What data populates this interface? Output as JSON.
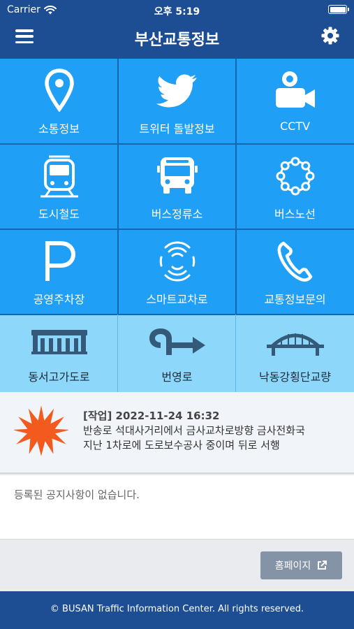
{
  "status_bar": {
    "carrier": "Carrier",
    "time": "오후 5:19"
  },
  "navbar": {
    "title": "부산교통정보"
  },
  "tiles": [
    {
      "label": "소통정보",
      "icon": "map-pin-icon"
    },
    {
      "label": "트위터 돌발정보",
      "icon": "twitter-bird-icon"
    },
    {
      "label": "CCTV",
      "icon": "video-camera-icon"
    },
    {
      "label": "도시철도",
      "icon": "subway-train-icon"
    },
    {
      "label": "버스정류소",
      "icon": "bus-icon"
    },
    {
      "label": "버스노선",
      "icon": "route-circle-icon"
    },
    {
      "label": "공영주차장",
      "icon": "parking-icon"
    },
    {
      "label": "스마트교차로",
      "icon": "smart-signal-icon"
    },
    {
      "label": "교통정보문의",
      "icon": "phone-icon"
    },
    {
      "label": "동서고가도로",
      "icon": "elevated-road-icon"
    },
    {
      "label": "번영로",
      "icon": "road-arrow-icon"
    },
    {
      "label": "낙동강횡단교량",
      "icon": "arch-bridge-icon"
    }
  ],
  "incident": {
    "title": "[작업] 2022-11-24 16:32",
    "line1": "반송로 석대사거리에서 금사교차로방향 금사전화국",
    "line2": "지난 1차로에 도로보수공사 중이며 뒤로 서행"
  },
  "notice": {
    "message": "등록된 공지사항이 없습니다."
  },
  "home_button": {
    "label": "홈페이지"
  },
  "footer": {
    "text": "© BUSAN Traffic Information Center. All rights reserved."
  },
  "colors": {
    "nav": "#1d4e93",
    "tile_dark": "#1f9ff5",
    "tile_light": "#8dd8fa",
    "accent_orange": "#f25a1e"
  }
}
